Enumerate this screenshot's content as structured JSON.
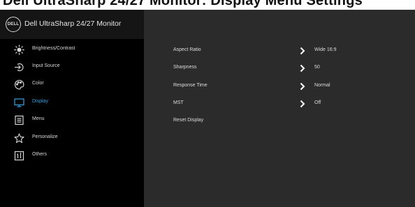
{
  "header_title": "Dell UltraSharp 24/27 Monitor: Display Menu Settings",
  "osd": {
    "logo_text": "DELL",
    "model_name": "Dell UltraSharp 24/27 Monitor"
  },
  "menu": [
    {
      "label": "Brightness/Contrast",
      "icon": "brightness-icon",
      "active": false
    },
    {
      "label": "Input Source",
      "icon": "input-source-icon",
      "active": false
    },
    {
      "label": "Color",
      "icon": "color-palette-icon",
      "active": false
    },
    {
      "label": "Display",
      "icon": "display-monitor-icon",
      "active": true
    },
    {
      "label": "Menu",
      "icon": "menu-list-icon",
      "active": false
    },
    {
      "label": "Personalize",
      "icon": "star-icon",
      "active": false
    },
    {
      "label": "Others",
      "icon": "others-info-icon",
      "active": false
    }
  ],
  "display_settings": [
    {
      "name": "Aspect Ratio",
      "value": "Wide 16:9",
      "has_submenu": true
    },
    {
      "name": "Sharpness",
      "value": "50",
      "has_submenu": true
    },
    {
      "name": "Response Time",
      "value": "Normal",
      "has_submenu": true
    },
    {
      "name": "MST",
      "value": "Off",
      "has_submenu": true
    },
    {
      "name": "Reset Display",
      "value": "",
      "has_submenu": false
    }
  ],
  "colors": {
    "sidebar_bg": "#000000",
    "panel_bg": "#2b2b2b",
    "active_accent": "#3aa0e6",
    "text": "#dcdcdc"
  }
}
